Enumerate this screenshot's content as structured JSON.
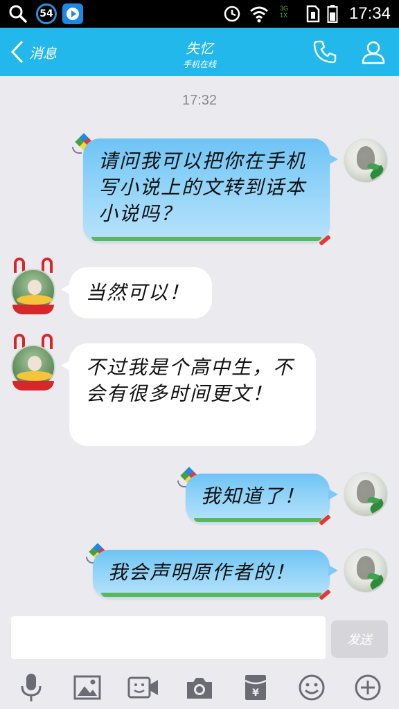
{
  "status_bar": {
    "notification_count": "54",
    "network": [
      "3G",
      "1X"
    ],
    "time": "17:34"
  },
  "header": {
    "back_label": "消息",
    "title": "失忆",
    "subtitle": "手机在线",
    "accent_color": "#22b8ec",
    "icons": [
      "phone-icon",
      "profile-icon"
    ]
  },
  "chat": {
    "timestamp": "17:32",
    "messages": [
      {
        "side": "right",
        "text": "请问我可以把你在手机写小说上的文转到话本小说吗？"
      },
      {
        "side": "left",
        "text": "当然可以！"
      },
      {
        "side": "left",
        "text": "不过我是个高中生，不会有很多时间更文！"
      },
      {
        "side": "right",
        "text": "我知道了！"
      },
      {
        "side": "right",
        "text": "我会声明原作者的！"
      }
    ]
  },
  "input": {
    "value": "",
    "send_label": "发送"
  },
  "toolbar": {
    "icons": [
      "microphone-icon",
      "image-icon",
      "video-call-icon",
      "camera-icon",
      "red-packet-icon",
      "emoji-icon",
      "add-icon"
    ]
  }
}
